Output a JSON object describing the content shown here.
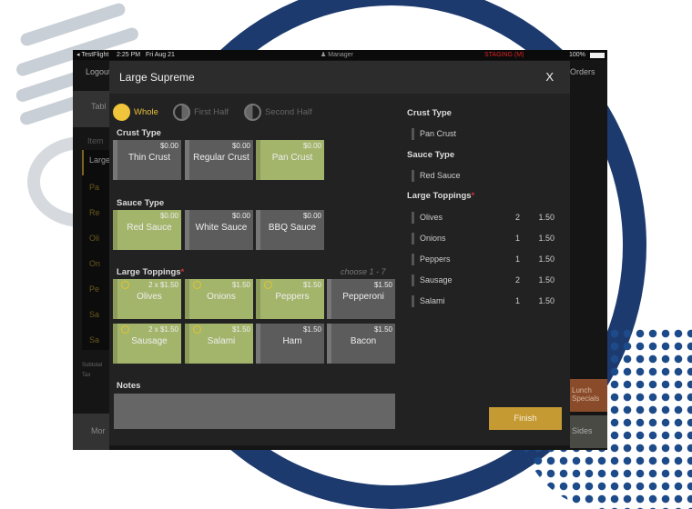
{
  "status_bar": {
    "back": "◂ TestFlight",
    "time": "2:25 PM",
    "date": "Fri Aug 21",
    "user": "Manager",
    "env": "STAGING (M)",
    "battery": "100%"
  },
  "background": {
    "logout": "Logout",
    "orders": "Orders",
    "tables": "Tabl",
    "item": "Item",
    "order_lines": [
      "Large",
      "Pa",
      "Re",
      "Oli",
      "On",
      "Pe",
      "Sa",
      "Sa"
    ],
    "subtotal": "Subtotal",
    "tax": "Tax",
    "lunch_specials": "Lunch Specials",
    "sides": "Sides",
    "more": "Mor"
  },
  "modal": {
    "title": "Large Supreme",
    "close": "X",
    "portions": [
      {
        "label": "Whole",
        "selected": true
      },
      {
        "label": "First Half",
        "selected": false
      },
      {
        "label": "Second Half",
        "selected": false
      }
    ],
    "crust": {
      "title": "Crust Type",
      "options": [
        {
          "label": "Thin Crust",
          "price": "$0.00",
          "selected": false
        },
        {
          "label": "Regular Crust",
          "price": "$0.00",
          "selected": false
        },
        {
          "label": "Pan Crust",
          "price": "$0.00",
          "selected": true
        }
      ]
    },
    "sauce": {
      "title": "Sauce Type",
      "options": [
        {
          "label": "Red Sauce",
          "price": "$0.00",
          "selected": true
        },
        {
          "label": "White Sauce",
          "price": "$0.00",
          "selected": false
        },
        {
          "label": "BBQ Sauce",
          "price": "$0.00",
          "selected": false
        }
      ]
    },
    "toppings": {
      "title": "Large Toppings",
      "required": "*",
      "hint": "choose 1 - 7",
      "options": [
        {
          "label": "Olives",
          "price": "2 x $1.50",
          "selected": true
        },
        {
          "label": "Onions",
          "price": "$1.50",
          "selected": true
        },
        {
          "label": "Peppers",
          "price": "$1.50",
          "selected": true
        },
        {
          "label": "Pepperoni",
          "price": "$1.50",
          "selected": false
        },
        {
          "label": "Sausage",
          "price": "2 x $1.50",
          "selected": true
        },
        {
          "label": "Salami",
          "price": "$1.50",
          "selected": true
        },
        {
          "label": "Ham",
          "price": "$1.50",
          "selected": false
        },
        {
          "label": "Bacon",
          "price": "$1.50",
          "selected": false
        }
      ]
    },
    "notes_label": "Notes",
    "summary": {
      "crust_title": "Crust Type",
      "crust": "Pan Crust",
      "sauce_title": "Sauce Type",
      "sauce": "Red Sauce",
      "toppings_title": "Large Toppings",
      "toppings_required": "*",
      "toppings": [
        {
          "name": "Olives",
          "qty": "2",
          "price": "1.50"
        },
        {
          "name": "Onions",
          "qty": "1",
          "price": "1.50"
        },
        {
          "name": "Peppers",
          "qty": "1",
          "price": "1.50"
        },
        {
          "name": "Sausage",
          "qty": "2",
          "price": "1.50"
        },
        {
          "name": "Salami",
          "qty": "1",
          "price": "1.50"
        }
      ]
    },
    "finish": "Finish"
  },
  "colors": {
    "selected": "#a3b56b",
    "unselected": "#5c5c5c",
    "accent": "#f0c43b",
    "finish": "#c59a33",
    "staging": "#d22"
  }
}
